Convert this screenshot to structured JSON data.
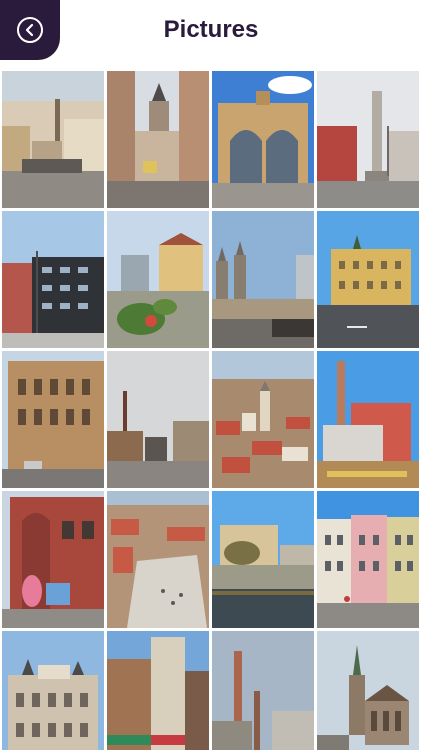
{
  "header": {
    "title": "Pictures",
    "back_icon": "back-arrow-icon",
    "accent_color": "#2a1a3c"
  },
  "gallery": {
    "columns": 4,
    "photos": [
      {
        "id": "photo-1",
        "scene": "plague-column-square"
      },
      {
        "id": "photo-2",
        "scene": "old-town-street-tower"
      },
      {
        "id": "photo-3",
        "scene": "brewery-gate"
      },
      {
        "id": "photo-4",
        "scene": "column-monument-square"
      },
      {
        "id": "photo-5",
        "scene": "modern-buildings"
      },
      {
        "id": "photo-6",
        "scene": "park-with-houses"
      },
      {
        "id": "photo-7",
        "scene": "city-skyline-towers"
      },
      {
        "id": "photo-8",
        "scene": "town-hall-yellow"
      },
      {
        "id": "photo-9",
        "scene": "brick-facade-street"
      },
      {
        "id": "photo-10",
        "scene": "industrial-street-grey-sky"
      },
      {
        "id": "photo-11",
        "scene": "aerial-old-town"
      },
      {
        "id": "photo-12",
        "scene": "factory-chimney-construction"
      },
      {
        "id": "photo-13",
        "scene": "red-brick-corner-mural"
      },
      {
        "id": "photo-14",
        "scene": "aerial-square"
      },
      {
        "id": "photo-15",
        "scene": "river-apartments"
      },
      {
        "id": "photo-16",
        "scene": "colorful-facades"
      },
      {
        "id": "photo-17",
        "scene": "ornate-theatre"
      },
      {
        "id": "photo-18",
        "scene": "shop-street"
      },
      {
        "id": "photo-19",
        "scene": "chimneys-industrial"
      },
      {
        "id": "photo-20",
        "scene": "gothic-cathedral"
      }
    ]
  }
}
